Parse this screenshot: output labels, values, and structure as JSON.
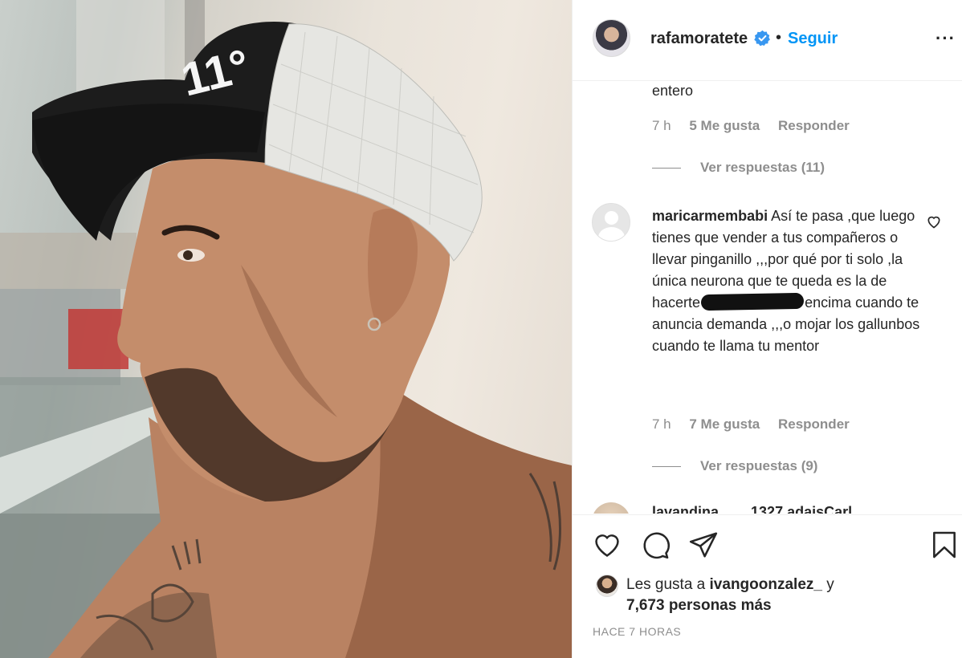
{
  "post": {
    "photo": {
      "cap_logo_text": "11°"
    },
    "header": {
      "username": "rafamoratete",
      "separator": "•",
      "follow_label": "Seguir",
      "more_label": "···"
    },
    "comments": [
      {
        "text_tail": "entero",
        "time": "7 h",
        "likes": "5 Me gusta",
        "reply_label": "Responder",
        "view_replies": "Ver respuestas (11)"
      },
      {
        "username": "maricarmembabi",
        "text_before_redaction": "Así te pasa ,que luego tienes que vender a tus compañeros o llevar pinganillo ,,,por qué por ti solo ,la única neurona que te queda es la de hacerte",
        "text_after_redaction": "encima cuando te anuncia demanda ,,,o mojar los gallunbos cuando te llama tu mentor",
        "time": "7 h",
        "likes": "7 Me gusta",
        "reply_label": "Responder",
        "view_replies": "Ver respuestas (9)"
      },
      {
        "username_partial": "lavandina........1327 adaisCarl"
      }
    ],
    "likes": {
      "prefix": "Les gusta a",
      "liker": "ivangoonzalez_",
      "connector": "y",
      "others": "7,673 personas más"
    },
    "timestamp": "HACE 7 HORAS"
  }
}
